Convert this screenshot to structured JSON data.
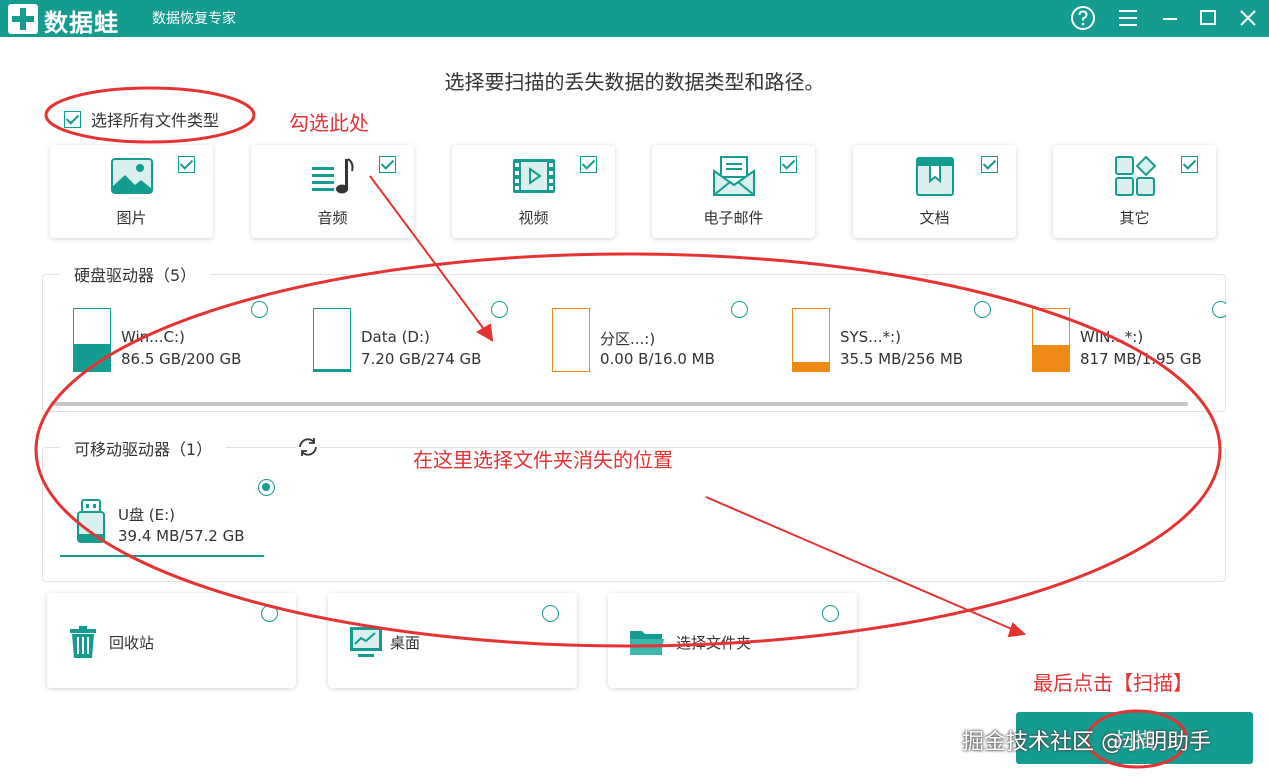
{
  "app": {
    "name": "数据蛙",
    "subtitle": "数据恢复专家"
  },
  "window_controls": [
    "help-icon",
    "menu-icon",
    "minimize-icon",
    "maximize-icon",
    "close-icon"
  ],
  "headline": "选择要扫描的丢失数据的数据类型和路径。",
  "select_all": {
    "label": "选择所有文件类型",
    "checked": true
  },
  "file_types": [
    {
      "label": "图片",
      "icon": "picture-icon",
      "checked": true
    },
    {
      "label": "音频",
      "icon": "audio-icon",
      "checked": true
    },
    {
      "label": "视频",
      "icon": "video-icon",
      "checked": true
    },
    {
      "label": "电子邮件",
      "icon": "email-icon",
      "checked": true
    },
    {
      "label": "文档",
      "icon": "document-icon",
      "checked": true
    },
    {
      "label": "其它",
      "icon": "other-icon",
      "checked": true
    }
  ],
  "hard_drives": {
    "title": "硬盘驱动器（5）",
    "items": [
      {
        "name": "Win...C:)",
        "size": "86.5 GB/200 GB",
        "used": 0.43,
        "color": "#159c91"
      },
      {
        "name": "Data (D:)",
        "size": "7.20 GB/274 GB",
        "used": 0.03,
        "color": "#159c91"
      },
      {
        "name": "分区...:)",
        "size": "0.00  B/16.0 MB",
        "used": 0.0,
        "color": "#ef8a17"
      },
      {
        "name": "SYS...*:)",
        "size": "35.5 MB/256 MB",
        "used": 0.14,
        "color": "#ef8a17"
      },
      {
        "name": "WIN...*:)",
        "size": "817 MB/1.95 GB",
        "used": 0.42,
        "color": "#ef8a17"
      }
    ]
  },
  "removable_drives": {
    "title": "可移动驱动器（1）",
    "items": [
      {
        "name": "U盘 (E:)",
        "size": "39.4 MB/57.2 GB",
        "selected": true
      }
    ]
  },
  "locations": [
    {
      "label": "回收站",
      "icon": "recycle-bin-icon"
    },
    {
      "label": "桌面",
      "icon": "desktop-icon"
    },
    {
      "label": "选择文件夹",
      "icon": "folder-icon"
    }
  ],
  "scan_button": "扫描",
  "annotations": {
    "check_here": "勾选此处",
    "select_location": "在这里选择文件夹消失的位置",
    "click_scan": "最后点击【扫描】"
  },
  "watermark": "掘金技术社区 @小明助手",
  "colors": {
    "accent": "#159c91",
    "orange": "#ef8a17",
    "annotation": "#e53333"
  }
}
